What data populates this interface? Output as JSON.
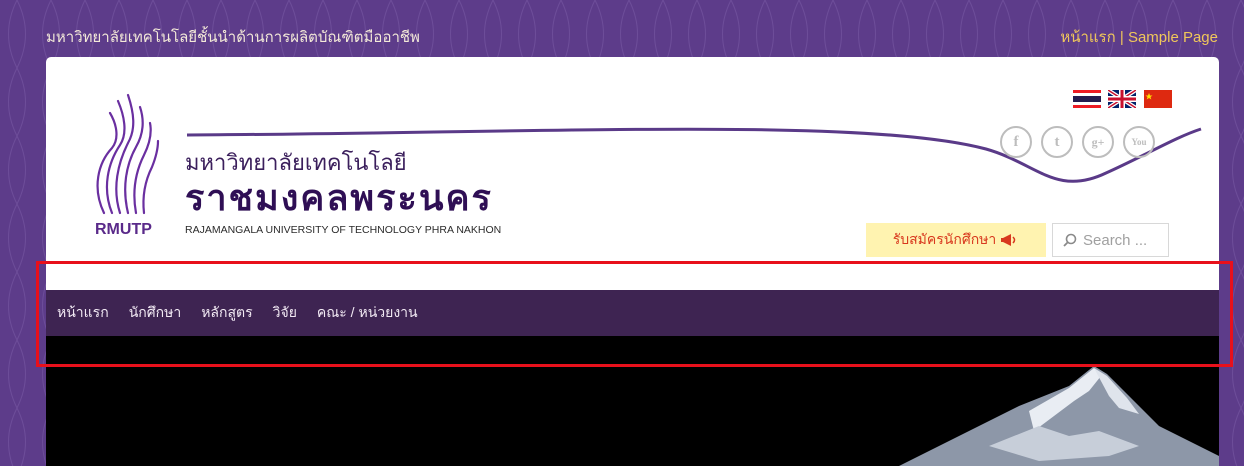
{
  "topbar": {
    "tagline": "มหาวิทยาลัยเทคโนโลยีชั้นนำด้านการผลิตบัณฑิตมืออาชีพ",
    "home_link": "หน้าแรก",
    "separator": "|",
    "sample_link": "Sample Page"
  },
  "header": {
    "logo_abbr": "RMUTP",
    "name_line1": "มหาวิทยาลัยเทคโนโลยี",
    "name_line2": "ราชมงคลพระนคร",
    "name_english": "RAJAMANGALA UNIVERSITY OF TECHNOLOGY PHRA NAKHON"
  },
  "languages": [
    {
      "name": "thai-flag-icon"
    },
    {
      "name": "uk-flag-icon"
    },
    {
      "name": "china-flag-icon"
    }
  ],
  "socials": [
    {
      "name": "facebook-icon",
      "glyph": "f"
    },
    {
      "name": "twitter-icon",
      "glyph": "t"
    },
    {
      "name": "google-plus-icon",
      "glyph": "g+"
    },
    {
      "name": "youtube-icon",
      "glyph": "You"
    }
  ],
  "apply_button": {
    "label": "รับสมัครนักศึกษา",
    "icon": "megaphone-icon"
  },
  "search": {
    "placeholder": "Search ..."
  },
  "nav": {
    "items": [
      "หน้าแรก",
      "นักศึกษา",
      "หลักสูตร",
      "วิจัย",
      "คณะ / หน่วยงาน"
    ]
  },
  "colors": {
    "background": "#5d3c8a",
    "navbar": "#3e2452",
    "accent_gold": "#f0c75a",
    "apply_bg": "#fff3b0",
    "apply_text": "#d8381e",
    "highlight": "#e8101b"
  }
}
